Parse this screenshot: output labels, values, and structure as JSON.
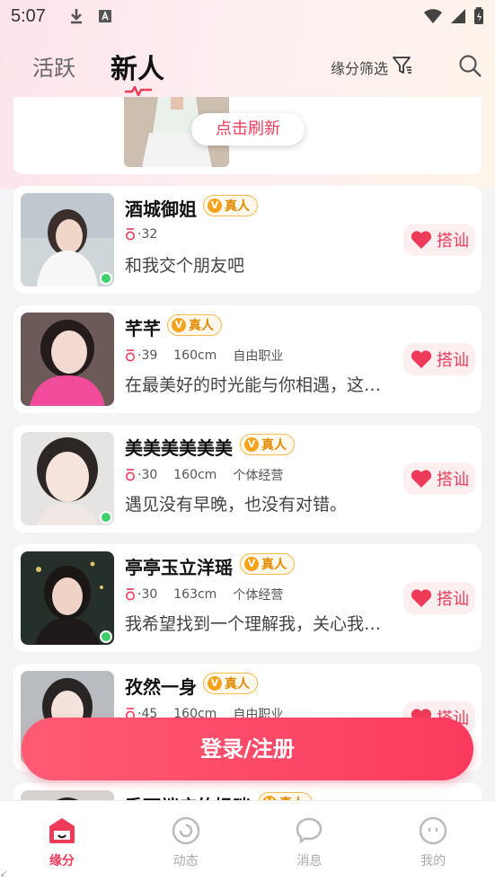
{
  "status_bar": {
    "time": "5:07"
  },
  "header": {
    "tabs": [
      {
        "label": "活跃"
      },
      {
        "label": "新人"
      }
    ],
    "filter_label": "缘分筛选"
  },
  "top_card": {
    "refresh_label": "点击刷新"
  },
  "users": [
    {
      "name": "酒城御姐",
      "badge": "真人",
      "age": "·32",
      "height": "",
      "job": "",
      "bio": "和我交个朋友吧",
      "online": true,
      "chat_label": "搭讪"
    },
    {
      "name": "芊芊",
      "badge": "真人",
      "age": "·39",
      "height": "160cm",
      "job": "自由职业",
      "bio": "在最美好的时光能与你相遇，这…",
      "online": false,
      "chat_label": "搭讪"
    },
    {
      "name": "美美美美美美",
      "badge": "真人",
      "age": "·30",
      "height": "160cm",
      "job": "个体经营",
      "bio": "遇见没有早晚，也没有对错。",
      "online": true,
      "chat_label": "搭讪"
    },
    {
      "name": "亭亭玉立洋瑶",
      "badge": "真人",
      "age": "·30",
      "height": "163cm",
      "job": "个体经营",
      "bio": "我希望找到一个理解我，关心我…",
      "online": true,
      "chat_label": "搭讪"
    },
    {
      "name": "孜然一身",
      "badge": "真人",
      "age": "·45",
      "height": "160cm",
      "job": "自由职业",
      "bio": "",
      "online": false,
      "chat_label": "搭讪"
    },
    {
      "name": "秀丽端庄的妈咪",
      "badge": "真人"
    }
  ],
  "login_button": "登录/注册",
  "bottom_nav": [
    {
      "label": "缘分"
    },
    {
      "label": "动态"
    },
    {
      "label": "消息"
    },
    {
      "label": "我的"
    }
  ],
  "colors": {
    "accent": "#ef3b5a",
    "badge": "#f7a21b",
    "online": "#3ed06a"
  }
}
